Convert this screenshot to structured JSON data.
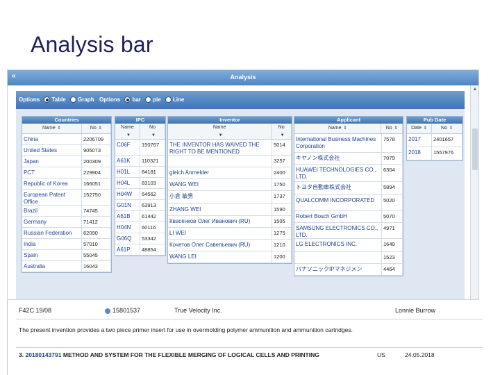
{
  "slide": {
    "title": "Analysis bar"
  },
  "window": {
    "title": "Analysis",
    "collapse_icon": "double-chevron-icon"
  },
  "options": {
    "label1": "Options",
    "radio1": [
      {
        "label": "Table",
        "selected": true
      },
      {
        "label": "Graph",
        "selected": false
      }
    ],
    "label2": "Options",
    "radio2": [
      {
        "label": "bar",
        "selected": true
      },
      {
        "label": "pie",
        "selected": false
      },
      {
        "label": "Line",
        "selected": false
      }
    ]
  },
  "countries": {
    "title": "Countries",
    "headers": [
      "Name",
      "No"
    ],
    "rows": [
      [
        "China",
        "2206709"
      ],
      [
        "United States",
        "905073"
      ],
      [
        "Japan",
        "200309"
      ],
      [
        "PCT",
        "229904"
      ],
      [
        "Republic of Korea",
        "166051"
      ],
      [
        "European Patent Office",
        "152750"
      ],
      [
        "Brazil",
        "74745"
      ],
      [
        "Germany",
        "71412"
      ],
      [
        "Russian Federation",
        "62090"
      ],
      [
        "India",
        "57010"
      ],
      [
        "Spain",
        "55045"
      ],
      [
        "Australia",
        "16043"
      ]
    ]
  },
  "ipc": {
    "title": "IPC",
    "headers": [
      "Name",
      "No"
    ],
    "rows": [
      [
        "C06F",
        "150767"
      ],
      [
        "A61K",
        "110321"
      ],
      [
        "H01L",
        "84181"
      ],
      [
        "H04L",
        "83103"
      ],
      [
        "H04W",
        "64562"
      ],
      [
        "G01N",
        "63913"
      ],
      [
        "A61B",
        "61442"
      ],
      [
        "H04N",
        "60116"
      ],
      [
        "G06Q",
        "53342"
      ],
      [
        "A61P",
        "48854"
      ]
    ]
  },
  "inventor": {
    "title": "Inventor",
    "headers": [
      "Name",
      "No"
    ],
    "rows": [
      [
        "THE INVENTOR HAS WAIVED THE RIGHT TO BE MENTIONED",
        "5014"
      ],
      [
        "",
        "3257"
      ],
      [
        "gleich Anmelder",
        "2400"
      ],
      [
        "WANG WEI",
        "1750"
      ],
      [
        "小倉 敏男",
        "1737"
      ],
      [
        "ZHANG WEI",
        "1590"
      ],
      [
        "Квасенков Олег Иванович (RU)",
        "1505"
      ],
      [
        "LI WEI",
        "1275"
      ],
      [
        "Кочетов Олег Савельевич (RU)",
        "1210"
      ],
      [
        "WANG LEI",
        "1200"
      ]
    ]
  },
  "applicant": {
    "title": "Applicant",
    "headers": [
      "Name",
      "No"
    ],
    "rows": [
      [
        "International Business Machines Corporation",
        "7578"
      ],
      [
        "キヤノン株式会社",
        "7079"
      ],
      [
        "HUAWEI TECHNOLOGIES CO., LTD.",
        "6304"
      ],
      [
        "トヨタ自動車株式会社",
        "5894"
      ],
      [
        "QUALCOMM INCORPORATED",
        "5020"
      ],
      [
        "Robert Bosch GmbH",
        "5070"
      ],
      [
        "SAMSUNG ELECTRONICS CO., LTD.",
        "4971"
      ],
      [
        "LG ELECTRONICS INC.",
        "1649"
      ],
      [
        "",
        "1523"
      ],
      [
        "パナソニックIPマネジメン",
        "4464"
      ]
    ]
  },
  "pubdate": {
    "title": "Pub Date",
    "headers": [
      "Date",
      "No"
    ],
    "rows": [
      [
        "2017",
        "2401657"
      ],
      [
        "2018",
        "1557976"
      ]
    ]
  },
  "detail": {
    "code": "F42C 19/08",
    "number": "15801537",
    "applicant": "True Velocity Inc.",
    "inventor": "Lonnie Burrow",
    "abstract": "The present invention provides a two piece primer insert for use in overmolding polymer ammunition and ammunition cartridges.",
    "next_index": "3.",
    "next_number": "20180143791",
    "next_title": "METHOD AND SYSTEM FOR THE FLEXIBLE MERGING OF LOGICAL CELLS AND PRINTING",
    "next_country": "US",
    "next_date": "24.05.2018"
  }
}
